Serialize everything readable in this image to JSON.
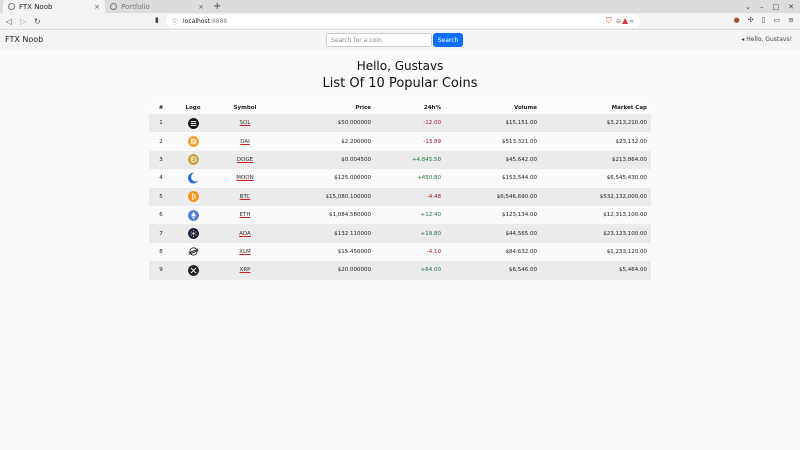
{
  "browser": {
    "tabs": [
      {
        "title": "FTX Noob",
        "active": true
      },
      {
        "title": "Portfolio",
        "active": false
      }
    ],
    "new_tab": "+",
    "close_glyph": "×",
    "url_host": "localhost",
    "url_port": ":8888"
  },
  "navbar": {
    "brand": "FTX Noob",
    "search_placeholder": "Search for a coin",
    "search_button": "Search",
    "user_menu": "Hello, Gustavs!"
  },
  "main": {
    "greeting": "Hello, Gustavs",
    "title": "List Of 10 Popular Coins"
  },
  "table": {
    "headers": {
      "num": "#",
      "logo": "Logo",
      "symbol": "Symbol",
      "price": "Price",
      "change": "24h%",
      "volume": "Volume",
      "cap": "Market Cap"
    },
    "rows": [
      {
        "num": "1",
        "symbol": "SOL",
        "price": "$50.000000",
        "change": "-12.00",
        "volume": "$15,151.00",
        "cap": "$3,213,210.00"
      },
      {
        "num": "2",
        "symbol": "DAI",
        "price": "$2.200000",
        "change": "-13.89",
        "volume": "$513,321.00",
        "cap": "$23,132.00"
      },
      {
        "num": "3",
        "symbol": "DOGE",
        "price": "$0.004500",
        "change": "+4,845.50",
        "volume": "$45,642.00",
        "cap": "$213,864.00"
      },
      {
        "num": "4",
        "symbol": "MOON",
        "price": "$125.000000",
        "change": "+450.80",
        "volume": "$153,544.00",
        "cap": "$6,545,430.00"
      },
      {
        "num": "5",
        "symbol": "BTC",
        "price": "$15,080.100000",
        "change": "-4.48",
        "volume": "$6,546,690.00",
        "cap": "$532,132,000.00"
      },
      {
        "num": "6",
        "symbol": "ETH",
        "price": "$1,084.580000",
        "change": "+12.40",
        "volume": "$123,134.00",
        "cap": "$12,313,100.00"
      },
      {
        "num": "7",
        "symbol": "ADA",
        "price": "$132.110000",
        "change": "+19.80",
        "volume": "$44,565.00",
        "cap": "$23,123,100.00"
      },
      {
        "num": "8",
        "symbol": "XLM",
        "price": "$15.456000",
        "change": "-4.10",
        "volume": "$84,632.00",
        "cap": "$1,233,120.00"
      },
      {
        "num": "9",
        "symbol": "XRP",
        "price": "$20.000000",
        "change": "+64.00",
        "volume": "$6,546.00",
        "cap": "$5,464.00"
      }
    ]
  },
  "colors": {
    "accent": "#0d6efd",
    "negative": "#a11a1a",
    "positive": "#19772d"
  },
  "icons": {
    "sol": "solana-logo-icon",
    "dai": "dai-logo-icon",
    "doge": "dogecoin-logo-icon",
    "moon": "moon-logo-icon",
    "btc": "bitcoin-logo-icon",
    "eth": "ethereum-logo-icon",
    "ada": "cardano-logo-icon",
    "xlm": "stellar-logo-icon",
    "xrp": "xrp-logo-icon"
  }
}
